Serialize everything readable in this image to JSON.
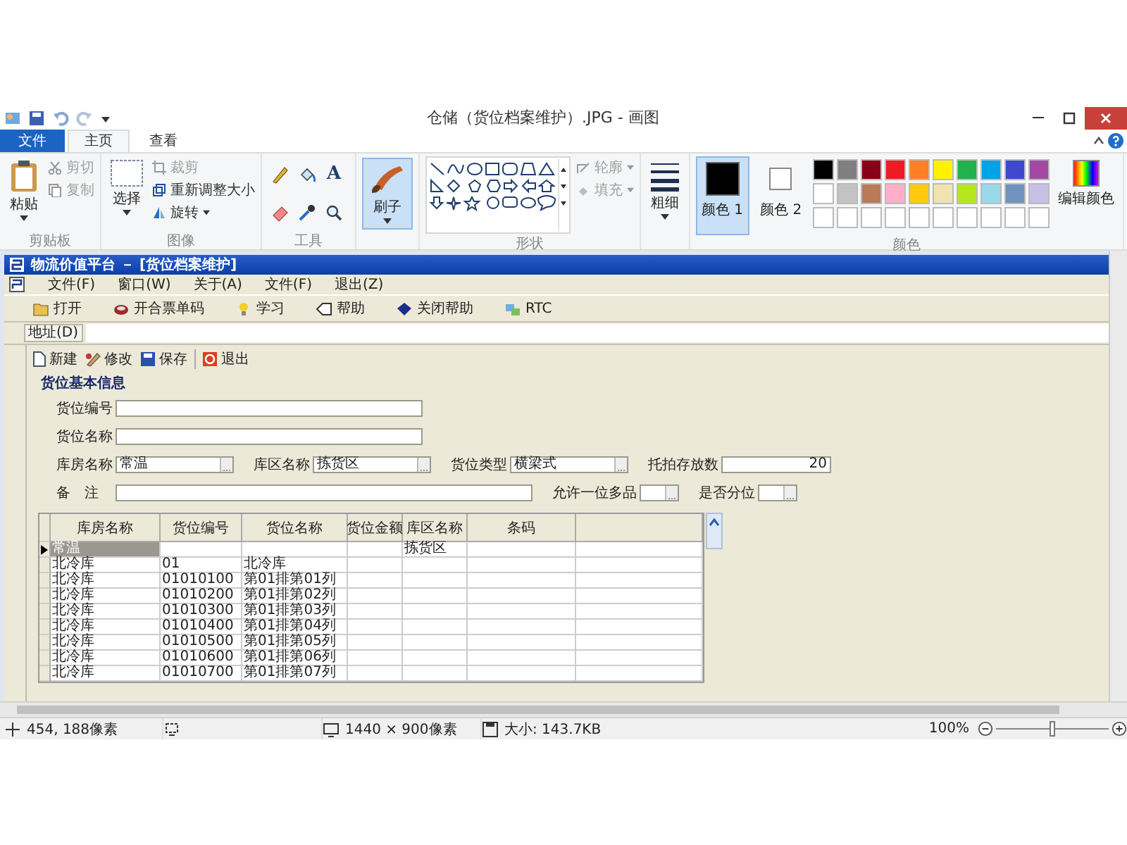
{
  "window": {
    "title": "仓储（货位档案维护）.JPG - 画图"
  },
  "ribbon_tabs": [
    {
      "label": "文件",
      "kind": "file",
      "selected": false
    },
    {
      "label": "主页",
      "kind": "tab",
      "selected": true
    },
    {
      "label": "查看",
      "kind": "tab",
      "selected": false
    }
  ],
  "ribbon": {
    "clipboard": {
      "label": "剪贴板",
      "paste": "粘贴",
      "actions": [
        {
          "label": "剪切",
          "kind": "cut",
          "disabled": true
        },
        {
          "label": "复制",
          "kind": "copy",
          "disabled": true
        }
      ]
    },
    "image": {
      "label": "图像",
      "select": "选择",
      "actions": [
        {
          "label": "裁剪",
          "kind": "crop",
          "disabled": true
        },
        {
          "label": "重新调整大小",
          "kind": "resize",
          "disabled": false
        },
        {
          "label": "旋转",
          "kind": "rotate",
          "disabled": false
        }
      ]
    },
    "tools": {
      "label": "工具",
      "text_glyph": "A"
    },
    "brushes": {
      "label": "刷子",
      "selected": true
    },
    "shapes": {
      "label": "形状",
      "options": [
        {
          "label": "轮廓",
          "kind": "outline",
          "disabled": true
        },
        {
          "label": "填充",
          "kind": "fill",
          "disabled": true
        }
      ]
    },
    "size": {
      "label": "粗细"
    },
    "colors": {
      "label": "颜色",
      "color1": {
        "label": "颜色 1",
        "color": "#000000",
        "selected": true
      },
      "color2": {
        "label": "颜色 2",
        "color": "#ffffff",
        "selected": false
      },
      "palette": [
        {
          "color": "#000000"
        },
        {
          "color": "#7f7f7f"
        },
        {
          "color": "#880015"
        },
        {
          "color": "#ed1c24"
        },
        {
          "color": "#ff7f27"
        },
        {
          "color": "#fff200"
        },
        {
          "color": "#22b14c"
        },
        {
          "color": "#00a2e8"
        },
        {
          "color": "#3f48cc"
        },
        {
          "color": "#a349a4"
        },
        {
          "color": "#ffffff"
        },
        {
          "color": "#c3c3c3"
        },
        {
          "color": "#b97a57"
        },
        {
          "color": "#ffaec9"
        },
        {
          "color": "#ffc90e"
        },
        {
          "color": "#efe4b0"
        },
        {
          "color": "#b5e61d"
        },
        {
          "color": "#99d9ea"
        },
        {
          "color": "#7092be"
        },
        {
          "color": "#c8bfe7"
        },
        {
          "color": "#ffffff"
        },
        {
          "color": "#ffffff"
        },
        {
          "color": "#ffffff"
        },
        {
          "color": "#ffffff"
        },
        {
          "color": "#ffffff"
        },
        {
          "color": "#ffffff"
        },
        {
          "color": "#ffffff"
        },
        {
          "color": "#ffffff"
        },
        {
          "color": "#ffffff"
        },
        {
          "color": "#ffffff"
        }
      ],
      "edit": "编辑颜色"
    }
  },
  "app": {
    "title": "物流价值平台 － [货位档案维护]",
    "menu": [
      "文件(F)",
      "窗口(W)",
      "关于(A)",
      "文件(F)",
      "退出(Z)"
    ],
    "toolbar": [
      {
        "label": "打开",
        "kind": "open"
      },
      {
        "label": "开合票单码",
        "kind": "ticket"
      },
      {
        "label": "学习",
        "kind": "bulb"
      },
      {
        "label": "帮助",
        "kind": "tag"
      },
      {
        "label": "关闭帮助",
        "kind": "book"
      },
      {
        "label": "RTC",
        "kind": "rtc"
      }
    ],
    "address": "地址(D)",
    "form_toolbar": [
      {
        "label": "新建",
        "kind": "new"
      },
      {
        "label": "修改",
        "kind": "edit"
      },
      {
        "label": "保存",
        "kind": "save"
      },
      {
        "label": "退出",
        "kind": "exit"
      }
    ],
    "section": "货位基本信息",
    "form_rows": [
      [
        {
          "label": "货位编号",
          "kind": "text"
        }
      ],
      [
        {
          "label": "货位名称",
          "kind": "text"
        }
      ],
      [
        {
          "label": "库房名称",
          "kind": "lookup",
          "value": "常温"
        },
        {
          "label": "库区名称",
          "kind": "lookup",
          "value": "拣货区"
        },
        {
          "label": "货位类型",
          "kind": "lookup",
          "value": "横梁式"
        },
        {
          "label": "托拍存放数",
          "kind": "number",
          "value": "20"
        }
      ],
      [
        {
          "label": "备　注",
          "kind": "memo"
        },
        {
          "label": "允许一位多品",
          "kind": "dropdown"
        },
        {
          "label": "是否分位",
          "kind": "dropdown"
        }
      ]
    ],
    "grid": {
      "columns": [
        "库房名称",
        "货位编号",
        "货位名称",
        "货位金额",
        "库区名称",
        "条码"
      ],
      "rows": [
        {
          "selected": true,
          "cells": [
            "常温",
            "",
            "",
            "",
            "拣货区",
            ""
          ]
        },
        {
          "selected": false,
          "cells": [
            "北冷库",
            "01",
            "北冷库",
            "",
            "",
            ""
          ]
        },
        {
          "selected": false,
          "cells": [
            "北冷库",
            "01010100",
            "第01排第01列",
            "",
            "",
            ""
          ]
        },
        {
          "selected": false,
          "cells": [
            "北冷库",
            "01010200",
            "第01排第02列",
            "",
            "",
            ""
          ]
        },
        {
          "selected": false,
          "cells": [
            "北冷库",
            "01010300",
            "第01排第03列",
            "",
            "",
            ""
          ]
        },
        {
          "selected": false,
          "cells": [
            "北冷库",
            "01010400",
            "第01排第04列",
            "",
            "",
            ""
          ]
        },
        {
          "selected": false,
          "cells": [
            "北冷库",
            "01010500",
            "第01排第05列",
            "",
            "",
            ""
          ]
        },
        {
          "selected": false,
          "cells": [
            "北冷库",
            "01010600",
            "第01排第06列",
            "",
            "",
            ""
          ]
        },
        {
          "selected": false,
          "cells": [
            "北冷库",
            "01010700",
            "第01排第07列",
            "",
            "",
            ""
          ]
        }
      ]
    }
  },
  "status_bar": {
    "cursor": "454, 188像素",
    "dimensions": "1440 × 900像素",
    "size": "大小: 143.7KB",
    "zoom": "100%",
    "zoom_slider": {
      "level": 0.5
    }
  }
}
